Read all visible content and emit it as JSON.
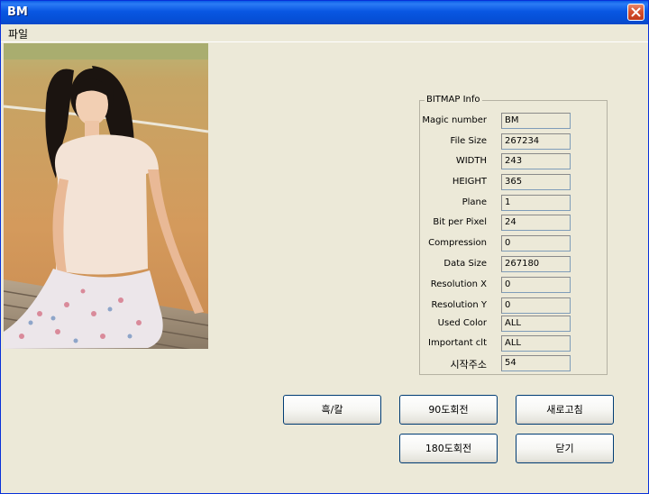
{
  "window": {
    "title": "BM"
  },
  "menu": {
    "file": "파일"
  },
  "bitmap_info": {
    "title": "BITMAP Info",
    "rows": [
      {
        "label": "Magic number",
        "value": "BM"
      },
      {
        "label": "File Size",
        "value": "267234"
      },
      {
        "label": "WIDTH",
        "value": "243"
      },
      {
        "label": "HEIGHT",
        "value": "365"
      },
      {
        "label": "Plane",
        "value": "1"
      },
      {
        "label": "Bit per Pixel",
        "value": "24"
      },
      {
        "label": "Compression",
        "value": "0"
      },
      {
        "label": "Data Size",
        "value": "267180"
      },
      {
        "label": "Resolution X",
        "value": "0"
      },
      {
        "label": "Resolution Y",
        "value": "0"
      },
      {
        "label": "Used Color",
        "value": "ALL"
      },
      {
        "label": "Important clt",
        "value": "ALL"
      },
      {
        "label": "시작주소",
        "value": "54"
      }
    ]
  },
  "buttons": {
    "bw": "흑/칼",
    "rotate90": "90도회전",
    "refresh": "새로고침",
    "rotate180": "180도회전",
    "close": "닫기"
  },
  "colors": {
    "titlebar": "#0a5ce6",
    "window_bg": "#ece9d8",
    "close_button": "#d6512f"
  }
}
